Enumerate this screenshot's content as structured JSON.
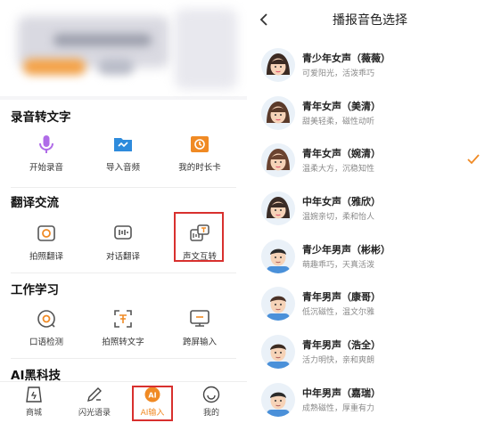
{
  "left": {
    "sections": [
      {
        "title": "录音转文字",
        "items": [
          {
            "label": "开始录音",
            "icon": "microphone-icon"
          },
          {
            "label": "导入音频",
            "icon": "folder-icon"
          },
          {
            "label": "我的时长卡",
            "icon": "clock-card-icon"
          }
        ]
      },
      {
        "title": "翻译交流",
        "items": [
          {
            "label": "拍照翻译",
            "icon": "camera-translate-icon"
          },
          {
            "label": "对话翻译",
            "icon": "dialog-translate-icon"
          },
          {
            "label": "声文互转",
            "icon": "voice-text-convert-icon"
          }
        ]
      },
      {
        "title": "工作学习",
        "items": [
          {
            "label": "口语检测",
            "icon": "speech-check-icon"
          },
          {
            "label": "拍照转文字",
            "icon": "photo-to-text-icon"
          },
          {
            "label": "跨屏输入",
            "icon": "cross-screen-icon"
          }
        ]
      },
      {
        "title": "AI黑科技",
        "items": []
      }
    ],
    "bottom_nav": [
      {
        "label": "商城",
        "icon": "shop-icon"
      },
      {
        "label": "闪光语录",
        "icon": "pen-icon"
      },
      {
        "label": "AI输入",
        "icon": "ai-input-icon",
        "active": true
      },
      {
        "label": "我的",
        "icon": "profile-icon"
      }
    ]
  },
  "right": {
    "title": "播报音色选择",
    "voices": [
      {
        "name": "青少年女声（薇薇）",
        "desc": "可爱阳光，活泼乖巧",
        "selected": false
      },
      {
        "name": "青年女声（美清）",
        "desc": "甜美轻柔，磁性动听",
        "selected": false
      },
      {
        "name": "青年女声（婉清）",
        "desc": "温柔大方，沉稳知性",
        "selected": true
      },
      {
        "name": "中年女声（雅欣）",
        "desc": "温婉亲切，柔和怡人",
        "selected": false
      },
      {
        "name": "青少年男声（彬彬）",
        "desc": "萌趣乖巧，天真活泼",
        "selected": false
      },
      {
        "name": "青年男声（康哥）",
        "desc": "低沉磁性，温文尔雅",
        "selected": false
      },
      {
        "name": "青年男声（浩全）",
        "desc": "活力明快，亲和爽朗",
        "selected": false
      },
      {
        "name": "中年男声（嘉瑞）",
        "desc": "成熟磁性，厚重有力",
        "selected": false
      }
    ]
  },
  "colors": {
    "accent_orange": "#f08a24",
    "accent_blue": "#2e8bdc",
    "accent_purple": "#9b5de5",
    "highlight_red": "#d8302e"
  }
}
